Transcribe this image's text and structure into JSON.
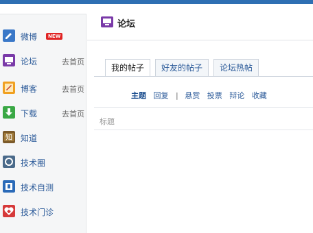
{
  "sidebar": {
    "items": [
      {
        "label": "微博",
        "badge": "NEW",
        "icon": "weibo-icon"
      },
      {
        "label": "论坛",
        "link": "去首页",
        "icon": "forum-icon"
      },
      {
        "label": "博客",
        "link": "去首页",
        "icon": "blog-icon"
      },
      {
        "label": "下载",
        "link": "去首页",
        "icon": "download-icon"
      },
      {
        "label": "知道",
        "icon": "zhidao-icon"
      },
      {
        "label": "技术圈",
        "icon": "tech-circle-icon"
      },
      {
        "label": "技术自测",
        "icon": "self-test-icon"
      },
      {
        "label": "技术门诊",
        "icon": "clinic-icon"
      }
    ]
  },
  "page": {
    "title": "论坛",
    "icon": "forum-icon"
  },
  "tabs": [
    {
      "label": "我的帖子",
      "active": true
    },
    {
      "label": "好友的帖子",
      "active": false
    },
    {
      "label": "论坛热帖",
      "active": false
    }
  ],
  "filters": {
    "topic": "主题",
    "reply": "回复",
    "separator": "|",
    "bounty": "悬赏",
    "vote": "投票",
    "debate": "辩论",
    "favorite": "收藏"
  },
  "table": {
    "column_title": "标题"
  },
  "colors": {
    "accent": "#2e6fb3",
    "link": "#2b5a99",
    "badge": "#e02424"
  }
}
